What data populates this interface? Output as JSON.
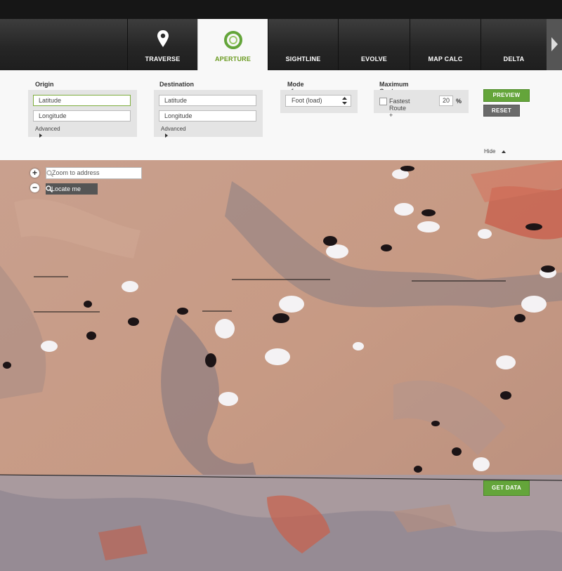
{
  "nav": {
    "tabs": [
      {
        "label": "TRAVERSE",
        "icon": "map-pin-icon"
      },
      {
        "label": "APERTURE",
        "icon": "aperture-ring-icon",
        "active": true
      },
      {
        "label": "SIGHTLINE"
      },
      {
        "label": "EVOLVE"
      },
      {
        "label": "MAP CALC"
      },
      {
        "label": "DELTA"
      }
    ],
    "more_icon": "chevron-right-icon"
  },
  "origin": {
    "title": "Origin",
    "latitude_placeholder": "Latitude",
    "longitude_placeholder": "Longitude",
    "advanced": "Advanced"
  },
  "destination": {
    "title": "Destination",
    "latitude_placeholder": "Latitude",
    "longitude_placeholder": "Longitude",
    "advanced": "Advanced"
  },
  "mode": {
    "title": "Mode of travel",
    "selected": "Foot (load)"
  },
  "cost": {
    "title": "Maximum Cost",
    "checkbox_label": "Fastest Route +",
    "value": "20",
    "unit": "%"
  },
  "actions": {
    "preview": "PREVIEW",
    "reset": "RESET",
    "hide": "Hide",
    "get_data": "GET DATA"
  },
  "map": {
    "zoom_in": "+",
    "zoom_out": "−",
    "search_placeholder": "Zoom to address",
    "locate": "Locate me"
  },
  "colors": {
    "accent": "#64a53a",
    "active_tab_text": "#6a9a1f"
  }
}
